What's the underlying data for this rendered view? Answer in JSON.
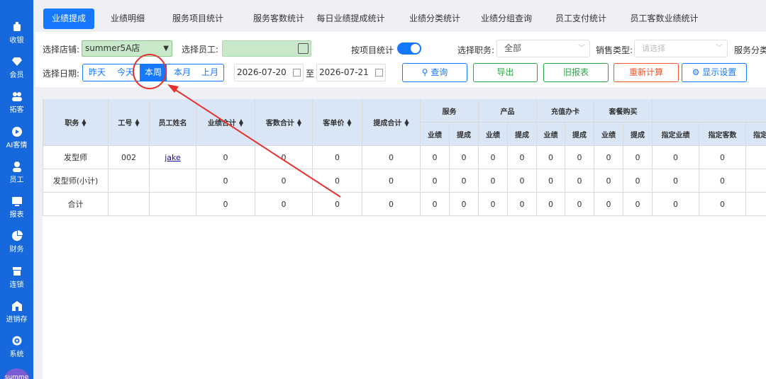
{
  "sidebar": {
    "items": [
      {
        "label": "收银",
        "icon": "cash-register-icon"
      },
      {
        "label": "会员",
        "icon": "diamond-icon"
      },
      {
        "label": "拓客",
        "icon": "users-icon"
      },
      {
        "label": "AI客情",
        "icon": "play-circle-icon"
      },
      {
        "label": "员工",
        "icon": "user-icon"
      },
      {
        "label": "报表",
        "icon": "monitor-icon"
      },
      {
        "label": "财务",
        "icon": "pie-chart-icon"
      },
      {
        "label": "连锁",
        "icon": "store-icon"
      },
      {
        "label": "进销存",
        "icon": "warehouse-icon"
      },
      {
        "label": "系统",
        "icon": "gear-icon"
      }
    ],
    "avatar_text": "summe"
  },
  "tabs": [
    {
      "label": "业绩提成",
      "active": true
    },
    {
      "label": "业绩明细"
    },
    {
      "label": "服务项目统计"
    },
    {
      "label": "服务客数统计"
    },
    {
      "label": "每日业绩提成统计"
    },
    {
      "label": "业绩分类统计"
    },
    {
      "label": "业绩分组查询"
    },
    {
      "label": "员工支付统计"
    },
    {
      "label": "员工客数业绩统计"
    }
  ],
  "filters": {
    "store_label": "选择店铺:",
    "store_value": "summer5A店",
    "employee_label": "选择员工:",
    "by_item_label": "按项目统计",
    "by_item_on": true,
    "position_label": "选择职务:",
    "position_value": "全部",
    "sale_type_label": "销售类型:",
    "sale_type_placeholder": "请选择",
    "service_cat_label": "服务分类",
    "date_label": "选择日期:",
    "date_buttons": [
      "昨天",
      "今天",
      "本周",
      "本月",
      "上月"
    ],
    "date_active": "本周",
    "date_from": "2026-07-20",
    "date_sep": "至",
    "date_to": "2026-07-21"
  },
  "actions": {
    "query": "查询",
    "export": "导出",
    "old_report": "旧报表",
    "recalc": "重新计算",
    "display_settings": "显示设置"
  },
  "colors": {
    "primary": "#1677ff",
    "export": "#27a745",
    "recalc": "#f5532b",
    "annotation": "#e8312f"
  },
  "table": {
    "headers": {
      "position": "职务",
      "emp_no": "工号",
      "emp_name": "员工姓名",
      "perf_total": "业绩合计",
      "guest_total": "客数合计",
      "unit_price": "客单价",
      "commission_total": "提成合计",
      "service": "服务",
      "product": "产品",
      "recharge": "充值办卡",
      "package": "套餐购买",
      "perf": "业绩",
      "commission": "提成",
      "designated_perf": "指定业绩",
      "designated_guests": "指定客数",
      "designated_more": "指定"
    },
    "rows": [
      {
        "position": "发型师",
        "emp_no": "002",
        "emp_name": "jake",
        "values": [
          "0",
          "0",
          "0",
          "0",
          "0",
          "0",
          "0",
          "0",
          "0",
          "0",
          "0",
          "0",
          "0",
          "0"
        ]
      },
      {
        "position": "发型师(小计)",
        "emp_no": "",
        "emp_name": "",
        "values": [
          "0",
          "0",
          "0",
          "0",
          "0",
          "0",
          "0",
          "0",
          "0",
          "0",
          "0",
          "0",
          "0",
          "0"
        ]
      },
      {
        "position": "合计",
        "emp_no": "",
        "emp_name": "",
        "values": [
          "0",
          "0",
          "0",
          "0",
          "0",
          "0",
          "0",
          "0",
          "0",
          "0",
          "0",
          "0",
          "0",
          "0"
        ]
      }
    ]
  }
}
